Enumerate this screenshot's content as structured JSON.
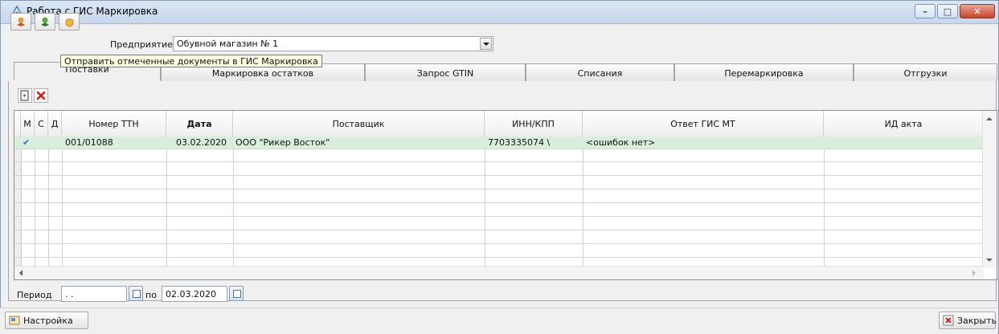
{
  "window": {
    "title": "Работа с ГИС Маркировка",
    "controls": [
      "minimize",
      "maximize",
      "close"
    ]
  },
  "toolbar": {
    "buttons": [
      {
        "icon": "receive-icon"
      },
      {
        "icon": "send-icon"
      },
      {
        "icon": "hand-icon"
      }
    ],
    "enterprise_label": "Предприятие",
    "enterprise_value": "Обувной магазин № 1"
  },
  "tooltip": "Отправить отмеченные документы в ГИС Маркировка",
  "tabs": [
    {
      "label": "Поставки",
      "active": true
    },
    {
      "label": "Маркировка остатков",
      "active": false
    },
    {
      "label": "Запрос GTIN",
      "active": false
    },
    {
      "label": "Списания",
      "active": false
    },
    {
      "label": "Перемаркировка",
      "active": false
    },
    {
      "label": "Отгрузки",
      "active": false
    }
  ],
  "subtoolbar": {
    "buttons": [
      {
        "icon": "new-document-icon"
      },
      {
        "icon": "delete-icon"
      }
    ]
  },
  "table": {
    "columns": [
      "М",
      "С",
      "Д",
      "Номер ТТН",
      "Дата",
      "Поставщик",
      "ИНН/КПП",
      "Ответ ГИС МТ",
      "ИД акта"
    ],
    "rows": [
      {
        "m": "✔",
        "c": "",
        "d": "",
        "ttn": "001/01088",
        "date": "03.02.2020",
        "supplier": "ООО \"Рикер Восток\"",
        "inn": "7703335074  \\",
        "answer": "<ошибок нет>",
        "act_id": ""
      }
    ],
    "empty_rows": 9
  },
  "period": {
    "label": "Период",
    "from": " . .",
    "to_label": "по",
    "to": "02.03.2020"
  },
  "bottom": {
    "settings_label": "Настройка",
    "close_label": "Закрыть"
  },
  "colors": {
    "selected_row": "#d9eedb",
    "check": "#2f6fd6",
    "delete": "#d11a1a"
  }
}
